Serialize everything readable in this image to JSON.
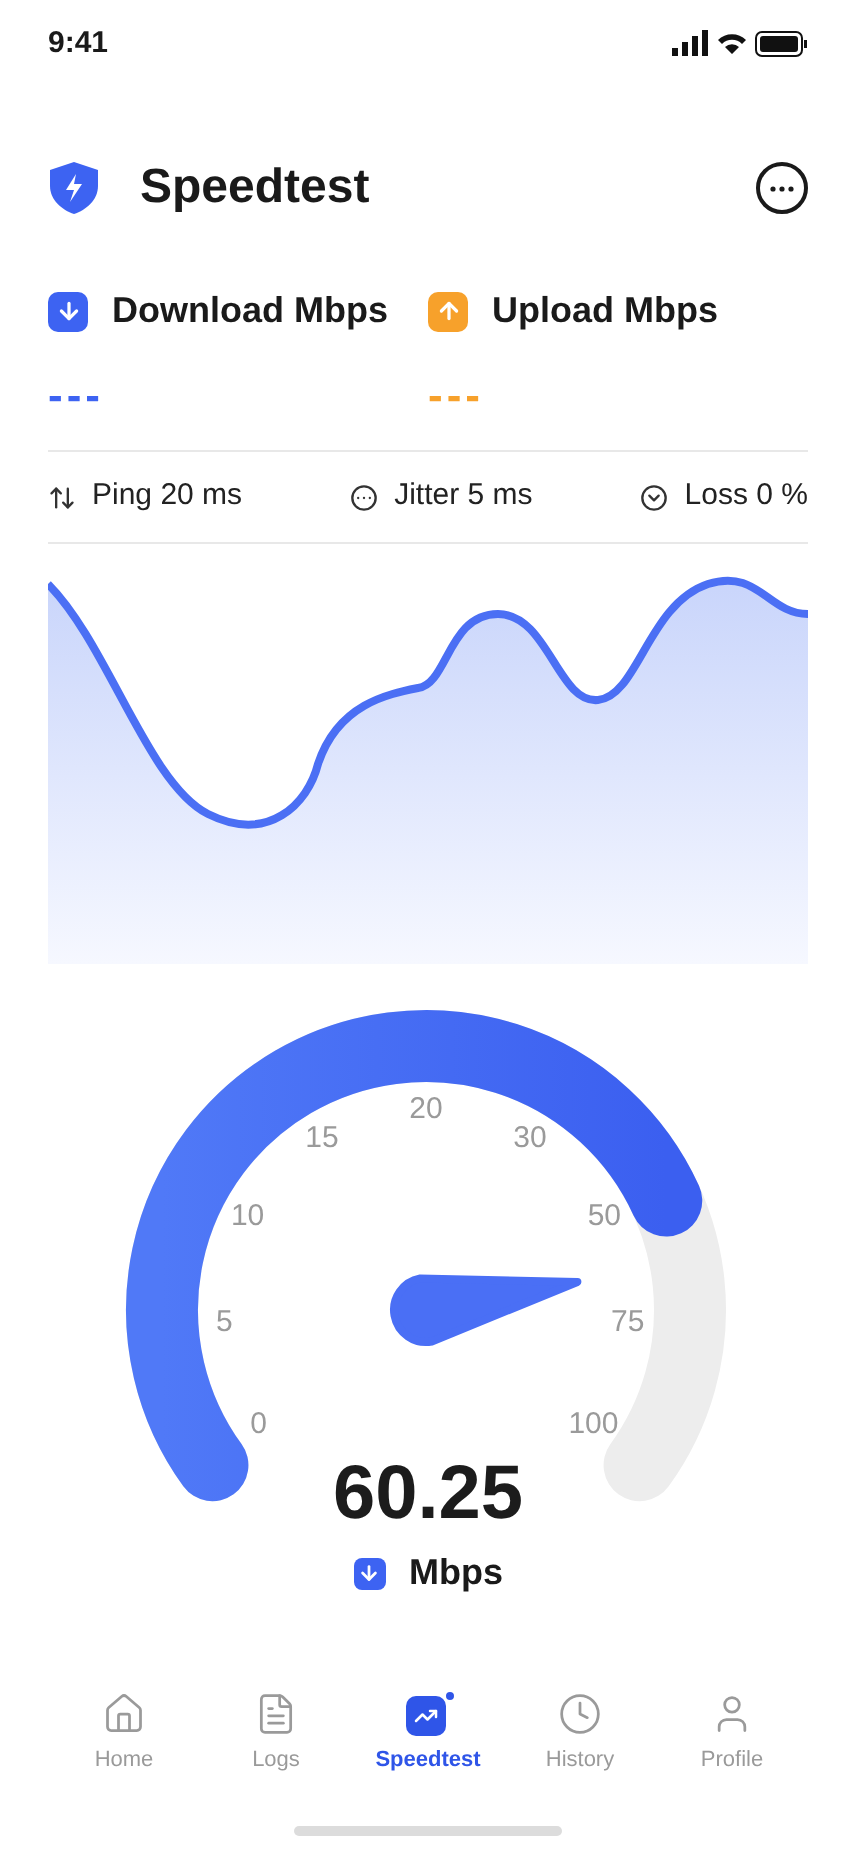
{
  "status_bar": {
    "time": "9:41"
  },
  "header": {
    "title": "Speedtest"
  },
  "metrics": [
    {
      "kind": "download",
      "label": "Download Mbps",
      "value": "---"
    },
    {
      "kind": "upload",
      "label": "Upload Mbps",
      "value": "---"
    }
  ],
  "stats": [
    {
      "kind": "ping",
      "label": "Ping 20 ms"
    },
    {
      "kind": "jitter",
      "label": "Jitter 5 ms"
    },
    {
      "kind": "loss",
      "label": "Loss 0 %"
    }
  ],
  "gauge": {
    "ticks": [
      "0",
      "5",
      "10",
      "15",
      "20",
      "30",
      "50",
      "75",
      "100"
    ],
    "reading": "60.25",
    "unit": "Mbps"
  },
  "tab_bar": [
    {
      "kind": "home",
      "label": "Home",
      "selected": false
    },
    {
      "kind": "logs",
      "label": "Logs",
      "selected": false
    },
    {
      "kind": "speedtest",
      "label": "Speedtest",
      "selected": true
    },
    {
      "kind": "history",
      "label": "History",
      "selected": false
    },
    {
      "kind": "profile",
      "label": "Profile",
      "selected": false
    }
  ]
}
